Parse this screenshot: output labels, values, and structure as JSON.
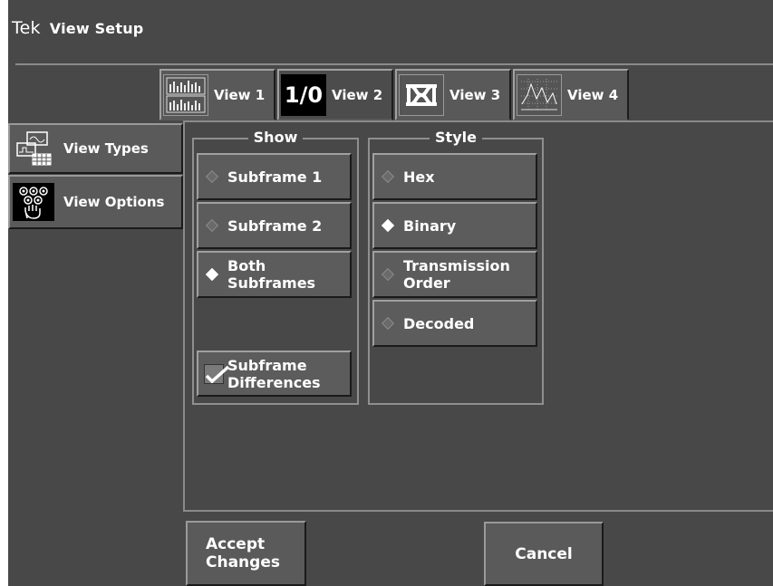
{
  "window": {
    "brand": "Tek",
    "title": "View Setup"
  },
  "tabs": [
    {
      "label": "View 1",
      "icon": "bar-chart-icon",
      "selected": false
    },
    {
      "label": "View 2",
      "icon": "io-binary-icon",
      "icon_text": "1/0",
      "selected": true
    },
    {
      "label": "View 3",
      "icon": "eye-pattern-icon",
      "selected": false
    },
    {
      "label": "View 4",
      "icon": "line-chart-icon",
      "selected": false
    }
  ],
  "sidebar": {
    "items": [
      {
        "label": "View Types",
        "icon": "view-types-icon"
      },
      {
        "label": "View Options",
        "icon": "hand-dots-icon",
        "selected": true
      }
    ]
  },
  "show_group": {
    "title": "Show",
    "options": [
      {
        "line1": "Subframe 1",
        "line2": "",
        "selected": false
      },
      {
        "line1": "Subframe 2",
        "line2": "",
        "selected": false
      },
      {
        "line1": "Both",
        "line2": "Subframes",
        "selected": true
      }
    ],
    "checkbox": {
      "line1": "Subframe",
      "line2": "Differences",
      "checked": true
    }
  },
  "style_group": {
    "title": "Style",
    "options": [
      {
        "line1": "Hex",
        "line2": "",
        "selected": false
      },
      {
        "line1": "Binary",
        "line2": "",
        "selected": true
      },
      {
        "line1": "Transmission",
        "line2": "Order",
        "selected": false
      },
      {
        "line1": "Decoded",
        "line2": "",
        "selected": false
      }
    ]
  },
  "footer": {
    "accept_line1": "Accept",
    "accept_line2": "Changes",
    "cancel_label": "Cancel"
  },
  "colors": {
    "background": "#484848",
    "button": "#5a5a5a",
    "text": "#ffffff"
  }
}
